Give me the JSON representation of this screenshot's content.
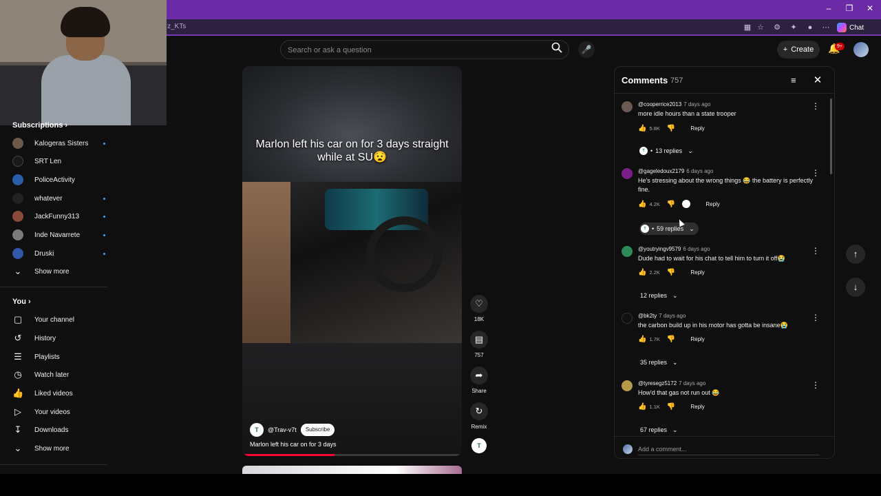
{
  "browser": {
    "url_fragment": "z_KTs",
    "chat_label": "Chat",
    "window_controls": [
      "minimize-icon",
      "restore-icon",
      "close-icon"
    ]
  },
  "header": {
    "search_placeholder": "Search or ask a question",
    "create_label": "Create",
    "notification_badge": "9+"
  },
  "sidebar": {
    "subscriptions_title": "Subscriptions",
    "subscriptions": [
      {
        "label": "Kalogeras Sisters",
        "avatar_color": "#6b5a4a",
        "new": true
      },
      {
        "label": "SRT Len",
        "avatar_color": "#1a1a1a",
        "new": false
      },
      {
        "label": "PoliceActivity",
        "avatar_color": "#2a5ea8",
        "new": false
      },
      {
        "label": "whatever",
        "avatar_color": "#222222",
        "new": true
      },
      {
        "label": "JackFunny313",
        "avatar_color": "#8a4a3a",
        "new": true
      },
      {
        "label": "Inde Navarrete",
        "avatar_color": "#7a7a7a",
        "new": true
      },
      {
        "label": "Druski",
        "avatar_color": "#3355aa",
        "new": true
      }
    ],
    "show_more_1": "Show more",
    "you_title": "You",
    "you_items": [
      {
        "label": "Your channel",
        "icon": "channel-icon"
      },
      {
        "label": "History",
        "icon": "history-icon"
      },
      {
        "label": "Playlists",
        "icon": "playlists-icon"
      },
      {
        "label": "Watch later",
        "icon": "watch-later-icon"
      },
      {
        "label": "Liked videos",
        "icon": "thumbs-up-icon"
      },
      {
        "label": "Your videos",
        "icon": "video-icon"
      },
      {
        "label": "Downloads",
        "icon": "download-icon"
      }
    ],
    "show_more_2": "Show more"
  },
  "short": {
    "caption": "Marlon left his car on for 3 days straight while at SU😧",
    "channel": "@Trav-v7t",
    "subscribe_label": "Subscribe",
    "title": "Marlon  left his car on for 3 days",
    "progress": 0.42,
    "actions": [
      {
        "icon": "heart-icon",
        "label": "18K"
      },
      {
        "icon": "comment-icon",
        "label": "757"
      },
      {
        "icon": "share-icon",
        "label": "Share"
      },
      {
        "icon": "remix-icon",
        "label": "Remix"
      }
    ]
  },
  "comments": {
    "title": "Comments",
    "count": "757",
    "items": [
      {
        "author": "@cooperrice2013",
        "time": "7 days ago",
        "text": "more idle hours than a state trooper",
        "likes": "5.8K",
        "reply_label": "Reply",
        "avatar_color": "#6a5a52",
        "replies": "13 replies",
        "replies_avatar": true
      },
      {
        "author": "@gageledoux2179",
        "time": "6 days ago",
        "text": "He's stressing about the wrong things 😂 the battery is perfectly fine.",
        "likes": "4.2K",
        "reply_label": "Reply",
        "avatar_color": "#7a1f8a",
        "replies": "59 replies",
        "replies_avatar": true
      },
      {
        "author": "@youtryingv9579",
        "time": "6 days ago",
        "text": "Dude had to wait for his chat to tell him to turn it off😭",
        "likes": "2.2K",
        "reply_label": "Reply",
        "avatar_color": "#2e8a5a",
        "replies": "12 replies",
        "replies_avatar": false
      },
      {
        "author": "@bk2ty",
        "time": "7 days ago",
        "text": "the carbon build up in his motor has gotta be insane😭",
        "likes": "1.7K",
        "reply_label": "Reply",
        "avatar_color": "#111111",
        "replies": "35 replies",
        "replies_avatar": false
      },
      {
        "author": "@tyresegz5172",
        "time": "7 days ago",
        "text": "How'd that gas not run out 😂",
        "likes": "1.1K",
        "reply_label": "Reply",
        "avatar_color": "#b59a4a",
        "replies": "67 replies",
        "replies_avatar": false
      }
    ],
    "add_placeholder": "Add a comment..."
  }
}
